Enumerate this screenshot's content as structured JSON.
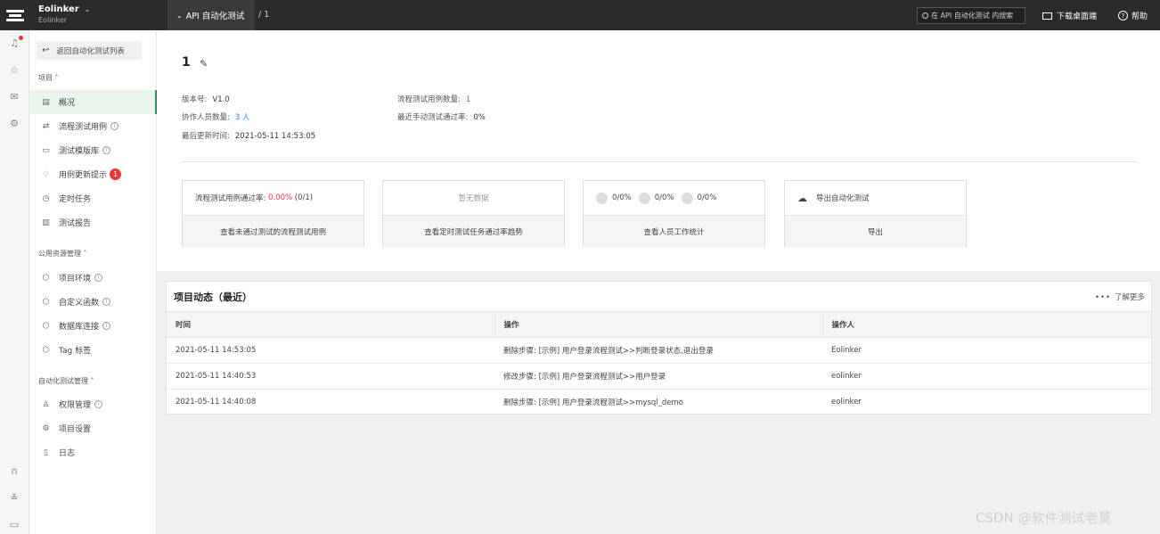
{
  "topbar": {
    "brand_name": "Eolinker",
    "brand_sub": "Eolinker",
    "project_tab": "API 自动化测试",
    "breadcrumb": "/ 1",
    "search_placeholder": "在 API 自动化测试 内搜索",
    "download_label": "下载桌面端",
    "help_label": "帮助"
  },
  "sidebar": {
    "back_label": "返回自动化测试列表",
    "group_project": "项目 ˄",
    "group_public": "公用资源管理 ˄",
    "group_automation": "自动化测试管理 ˄",
    "items": [
      {
        "label": "概况",
        "icon": "overview-icon"
      },
      {
        "label": "流程测试用例",
        "icon": "flow-icon"
      },
      {
        "label": "测试模版库",
        "icon": "template-icon"
      },
      {
        "label": "用例更新提示",
        "icon": "bell-icon",
        "badge": "1"
      },
      {
        "label": "定时任务",
        "icon": "clock-icon"
      },
      {
        "label": "测试报告",
        "icon": "report-icon"
      },
      {
        "label": "项目环境",
        "icon": "cube-icon"
      },
      {
        "label": "自定义函数",
        "icon": "cube-icon"
      },
      {
        "label": "数据库连接",
        "icon": "cube-icon"
      },
      {
        "label": "Tag 标签",
        "icon": "cube-icon"
      },
      {
        "label": "权限管理",
        "icon": "users-icon"
      },
      {
        "label": "项目设置",
        "icon": "settings-icon"
      },
      {
        "label": "日志",
        "icon": "log-icon"
      }
    ]
  },
  "overview": {
    "title": "1",
    "version_label": "版本号:",
    "version_value": "V1.0",
    "collab_label": "协作人员数量:",
    "collab_value": "3 人",
    "updated_label": "最后更新时间:",
    "updated_value": "2021-05-11 14:53:05",
    "cases_label": "流程测试用例数量:",
    "cases_value": "1",
    "pass_label": "最近手动测试通过率:",
    "pass_value": "0%"
  },
  "cards": {
    "c1_label": "流程测试用例通过率:",
    "c1_rate": "0.00%",
    "c1_count": "(0/1)",
    "c1_link": "查看未通过测试的流程测试用例",
    "c2_empty": "暂无数据",
    "c2_link": "查看定时测试任务通过率趋势",
    "c3_s1": "0/0%",
    "c3_s2": "0/0%",
    "c3_s3": "0/0%",
    "c3_link": "查看人员工作统计",
    "c4_label": "导出自动化测试",
    "c4_link": "导出"
  },
  "activity": {
    "title": "项目动态（最近）",
    "more": "了解更多",
    "columns": [
      "时间",
      "操作",
      "操作人"
    ],
    "rows": [
      [
        "2021-05-11 14:53:05",
        "删除步骤: [示例] 用户登录流程测试>>判断登录状态,退出登录",
        "Eolinker"
      ],
      [
        "2021-05-11 14:40:53",
        "修改步骤: [示例] 用户登录流程测试>>用户登录",
        "eolinker"
      ],
      [
        "2021-05-11 14:40:08",
        "删除步骤: [示例] 用户登录流程测试>>mysql_demo",
        "eolinker"
      ]
    ]
  },
  "watermark": "CSDN @软件测试老莫"
}
